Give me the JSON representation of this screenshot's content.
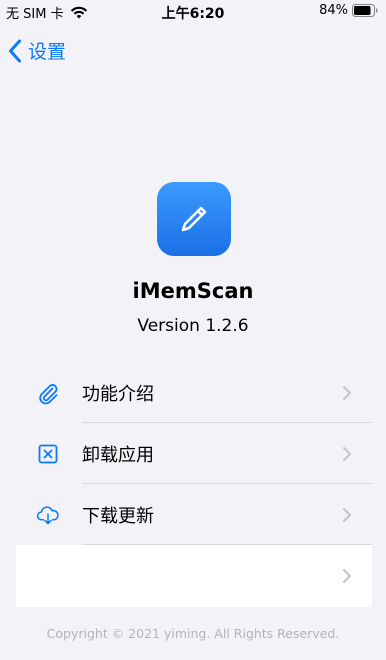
{
  "status_bar": {
    "carrier": "无 SIM 卡",
    "time": "上午6:20",
    "battery": "84%"
  },
  "nav": {
    "back_label": "设置"
  },
  "app": {
    "name": "iMemScan",
    "version": "Version 1.2.6",
    "icon": "pencil-icon"
  },
  "menu": {
    "items": [
      {
        "label": "功能介绍",
        "icon": "paperclip-icon"
      },
      {
        "label": "卸载应用",
        "icon": "delete-box-icon"
      },
      {
        "label": "下载更新",
        "icon": "cloud-download-icon"
      },
      {
        "label": "",
        "icon": ""
      }
    ]
  },
  "footer": {
    "copyright": "Copyright © 2021 yiming. All Rights Reserved."
  },
  "colors": {
    "accent": "#0a7aff",
    "background": "#f2f2f7",
    "chevron": "#c4c4c7"
  }
}
